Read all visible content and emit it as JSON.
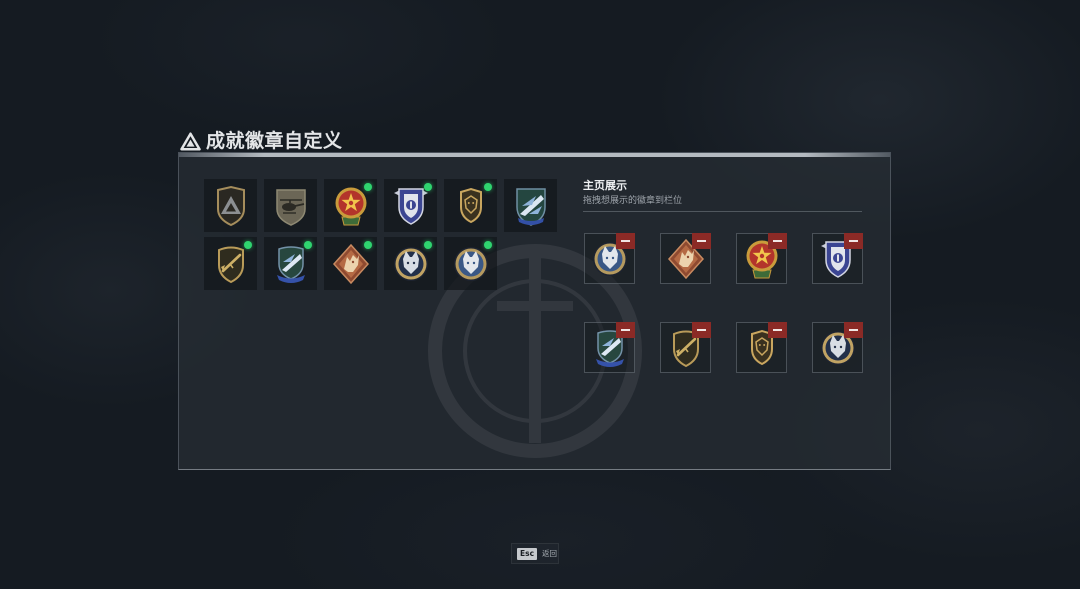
{
  "page": {
    "title": "成就徽章自定义",
    "logo_icon": "game-logo-icon"
  },
  "colors": {
    "background": "#151b22",
    "title_text": "#e3e5e7",
    "selected_indicator": "#2fd46f",
    "remove_button": "#8b2a26"
  },
  "inventory": {
    "badges": [
      {
        "icon": "triangle-emblem-badge",
        "selected": false
      },
      {
        "icon": "helicopter-badge",
        "selected": false
      },
      {
        "icon": "red-star-medal-badge",
        "selected": true
      },
      {
        "icon": "blue-star-shield-badge",
        "selected": true
      },
      {
        "icon": "gold-lion-shield-badge",
        "selected": true
      },
      {
        "icon": "eagle-wing-shield-badge",
        "selected": false
      },
      {
        "icon": "rifle-round-badge",
        "selected": true
      },
      {
        "icon": "eagle-round-badge",
        "selected": true
      },
      {
        "icon": "dragon-diamond-badge",
        "selected": true
      },
      {
        "icon": "wolf-round-badge",
        "selected": true
      },
      {
        "icon": "wolf-blue-round-badge",
        "selected": true
      }
    ]
  },
  "showcase": {
    "title": "主页展示",
    "subtitle": "拖拽想展示的徽章到栏位",
    "remove_icon": "minus-icon",
    "slots": [
      {
        "icon": "wolf-blue-round-badge"
      },
      {
        "icon": "dragon-diamond-badge"
      },
      {
        "icon": "red-star-medal-badge"
      },
      {
        "icon": "blue-star-shield-badge"
      },
      {
        "icon": "eagle-round-badge"
      },
      {
        "icon": "rifle-round-badge"
      },
      {
        "icon": "gold-lion-shield-badge"
      },
      {
        "icon": "wolf-round-badge"
      }
    ]
  },
  "footer": {
    "key": "Esc",
    "label": "返回"
  }
}
